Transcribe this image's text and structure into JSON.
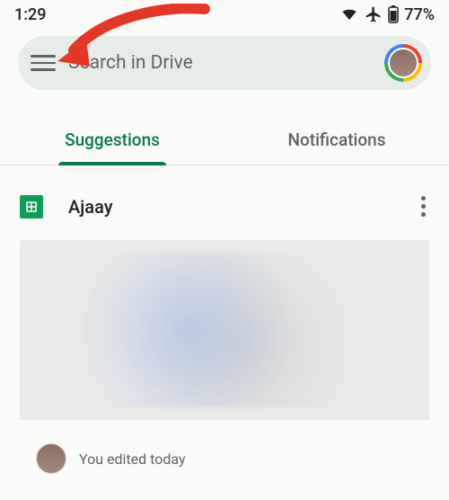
{
  "status": {
    "time": "1:29",
    "battery": "77%"
  },
  "search": {
    "placeholder": "Search in Drive"
  },
  "tabs": {
    "suggestions": "Suggestions",
    "notifications": "Notifications"
  },
  "file": {
    "icon": "sheets-icon",
    "title": "Ajaay",
    "activity": "You edited today"
  }
}
